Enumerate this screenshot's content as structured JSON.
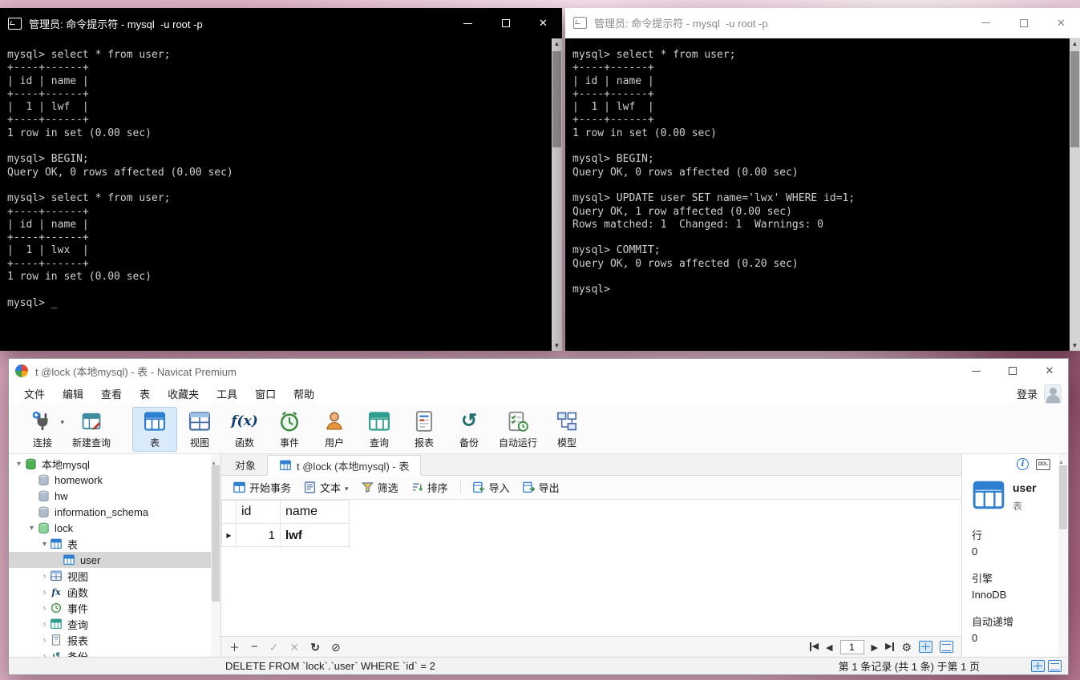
{
  "terminal_left": {
    "title": "管理员: 命令提示符 - mysql  -u root -p",
    "lines": [
      "mysql> select * from user;",
      "+----+------+",
      "| id | name |",
      "+----+------+",
      "|  1 | lwf  |",
      "+----+------+",
      "1 row in set (0.00 sec)",
      "",
      "mysql> BEGIN;",
      "Query OK, 0 rows affected (0.00 sec)",
      "",
      "mysql> select * from user;",
      "+----+------+",
      "| id | name |",
      "+----+------+",
      "|  1 | lwx  |",
      "+----+------+",
      "1 row in set (0.00 sec)",
      "",
      "mysql> _"
    ]
  },
  "terminal_right": {
    "title": "管理员: 命令提示符 - mysql  -u root -p",
    "lines": [
      "mysql> select * from user;",
      "+----+------+",
      "| id | name |",
      "+----+------+",
      "|  1 | lwf  |",
      "+----+------+",
      "1 row in set (0.00 sec)",
      "",
      "mysql> BEGIN;",
      "Query OK, 0 rows affected (0.00 sec)",
      "",
      "mysql> UPDATE user SET name='lwx' WHERE id=1;",
      "Query OK, 1 row affected (0.00 sec)",
      "Rows matched: 1  Changed: 1  Warnings: 0",
      "",
      "mysql> COMMIT;",
      "Query OK, 0 rows affected (0.20 sec)",
      "",
      "mysql>"
    ]
  },
  "navicat": {
    "title": "t @lock (本地mysql) - 表 - Navicat Premium",
    "menu": {
      "items": [
        "文件",
        "编辑",
        "查看",
        "表",
        "收藏夹",
        "工具",
        "窗口",
        "帮助"
      ],
      "login": "登录"
    },
    "toolbar": {
      "items": [
        {
          "label": "连接"
        },
        {
          "label": "新建查询"
        },
        {
          "label": "表"
        },
        {
          "label": "视图"
        },
        {
          "label": "函数"
        },
        {
          "label": "事件"
        },
        {
          "label": "用户"
        },
        {
          "label": "查询"
        },
        {
          "label": "报表"
        },
        {
          "label": "备份"
        },
        {
          "label": "自动运行"
        },
        {
          "label": "模型"
        }
      ]
    },
    "tree": {
      "items": [
        {
          "label": "本地mysql"
        },
        {
          "label": "homework"
        },
        {
          "label": "hw"
        },
        {
          "label": "information_schema"
        },
        {
          "label": "lock"
        },
        {
          "label": "表"
        },
        {
          "label": "user"
        },
        {
          "label": "视图"
        },
        {
          "label": "函数"
        },
        {
          "label": "事件"
        },
        {
          "label": "查询"
        },
        {
          "label": "报表"
        },
        {
          "label": "备份"
        }
      ]
    },
    "tabs": {
      "objects": "对象",
      "active": "t @lock (本地mysql) - 表"
    },
    "gridbar": {
      "begin_transaction": "开始事务",
      "text": "文本",
      "filter": "筛选",
      "sort": "排序",
      "import": "导入",
      "export": "导出"
    },
    "grid": {
      "columns": [
        "id",
        "name"
      ],
      "rows": [
        {
          "id": "1",
          "name": "lwf"
        }
      ]
    },
    "pagination": {
      "page": "1"
    },
    "info_panel": {
      "ddl": "DDL",
      "name": "user",
      "type": "表",
      "rows_label": "行",
      "rows_value": "0",
      "engine_label": "引擎",
      "engine_value": "InnoDB",
      "autoinc_label": "自动递增",
      "autoinc_value": "0"
    },
    "status_bar": {
      "sql": "DELETE FROM `lock`.`user` WHERE `id` = 2",
      "record_info": "第 1 条记录 (共 1 条) 于第 1 页"
    }
  }
}
